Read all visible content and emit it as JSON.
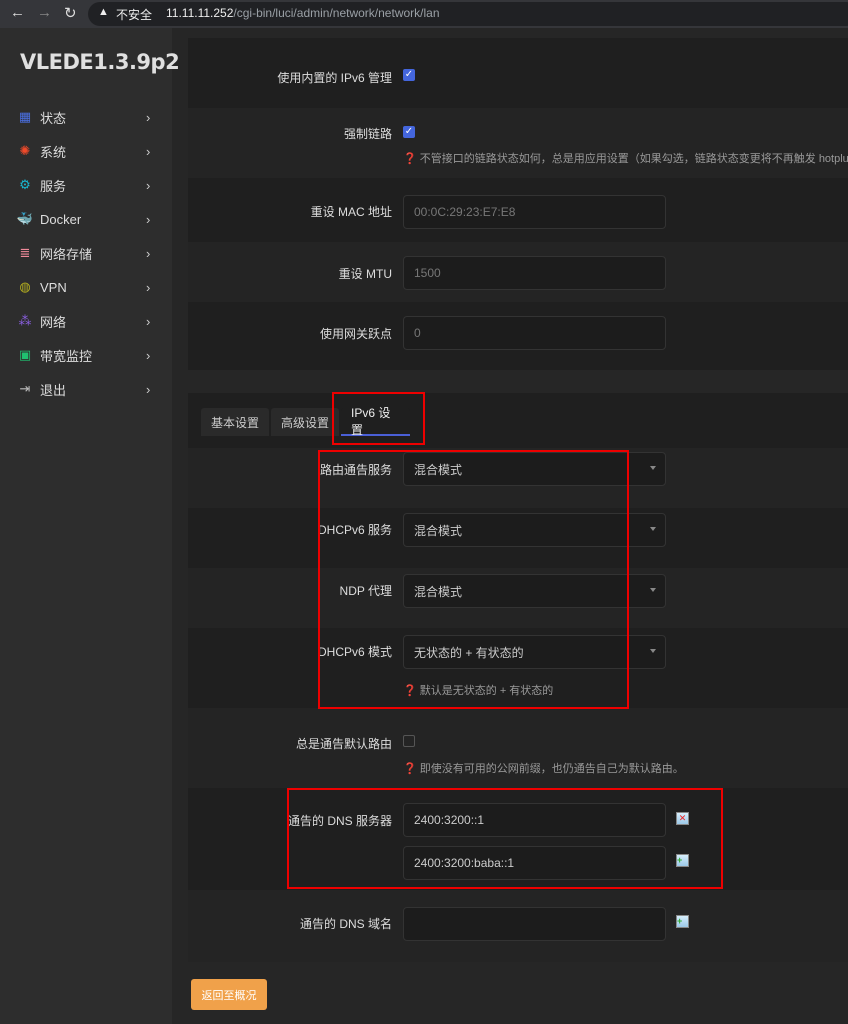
{
  "browser": {
    "security_label": "不安全",
    "url_host": "11.11.11.252",
    "url_path": "/cgi-bin/luci/admin/network/network/lan"
  },
  "sidebar": {
    "logo": "VLEDE1.3.9p2",
    "items": [
      {
        "label": "状态",
        "icon": "dashboard-icon",
        "color": "#4a6fe0"
      },
      {
        "label": "系统",
        "icon": "gear-icon",
        "color": "#f04a2a"
      },
      {
        "label": "服务",
        "icon": "cogs-icon",
        "color": "#19b7d0"
      },
      {
        "label": "Docker",
        "icon": "docker-icon",
        "color": "#3d8de0"
      },
      {
        "label": "网络存储",
        "icon": "database-icon",
        "color": "#f08a9a"
      },
      {
        "label": "VPN",
        "icon": "globe-lock-icon",
        "color": "#b6b020"
      },
      {
        "label": "网络",
        "icon": "sitemap-icon",
        "color": "#8a5fe0"
      },
      {
        "label": "带宽监控",
        "icon": "monitor-icon",
        "color": "#20c070"
      },
      {
        "label": "退出",
        "icon": "logout-icon",
        "color": "#bbbbbb"
      }
    ]
  },
  "general": {
    "ipv6_mgmt": {
      "label": "使用内置的 IPv6 管理",
      "checked": true
    },
    "force_link": {
      "label": "强制链路",
      "checked": true,
      "help": "不管接口的链路状态如何，总是用应用设置（如果勾选，链路状态变更将不再触发 hotplug 事"
    },
    "mac": {
      "label": "重设 MAC 地址",
      "placeholder": "00:0C:29:23:E7:E8"
    },
    "mtu": {
      "label": "重设 MTU",
      "placeholder": "1500"
    },
    "metric": {
      "label": "使用网关跃点",
      "placeholder": "0"
    }
  },
  "tabs": [
    {
      "label": "基本设置"
    },
    {
      "label": "高级设置"
    },
    {
      "label": "IPv6 设置",
      "active": true
    }
  ],
  "ipv6": {
    "ra": {
      "label": "路由通告服务",
      "value": "混合模式"
    },
    "dhcpv6": {
      "label": "DHCPv6 服务",
      "value": "混合模式"
    },
    "ndp": {
      "label": "NDP 代理",
      "value": "混合模式"
    },
    "ra_mode": {
      "label": "DHCPv6 模式",
      "value": "无状态的 + 有状态的",
      "help": "默认是无状态的 + 有状态的"
    },
    "default_route": {
      "label": "总是通告默认路由",
      "checked": false,
      "help": "即使没有可用的公网前缀，也仍通告自己为默认路由。"
    },
    "dns": {
      "label": "通告的 DNS 服务器",
      "values": [
        "2400:3200::1",
        "2400:3200:baba::1"
      ]
    },
    "domain": {
      "label": "通告的 DNS 域名",
      "value": ""
    }
  },
  "footer": {
    "back_label": "返回至概况"
  }
}
